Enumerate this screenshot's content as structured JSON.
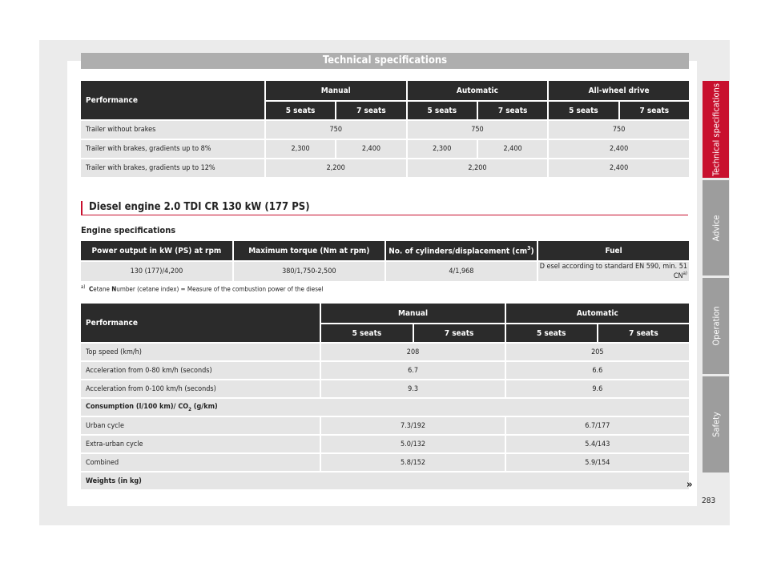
{
  "title": "Technical specifications",
  "table1": {
    "header_performance": "Performance",
    "groups": [
      "Manual",
      "Automatic",
      "All-wheel drive"
    ],
    "seats": [
      "5 seats",
      "7 seats",
      "5 seats",
      "7 seats",
      "5 seats",
      "7 seats"
    ],
    "rows": [
      {
        "label": "Trailer without brakes",
        "manual": "750",
        "automatic": "750",
        "awd": "750"
      },
      {
        "label": "Trailer with brakes, gradients up to 8%",
        "m5": "2,300",
        "m7": "2,400",
        "a5": "2,300",
        "a7": "2,400",
        "awd": "2,400"
      },
      {
        "label": "Trailer with brakes, gradients up to 12%",
        "manual": "2,200",
        "automatic": "2,200",
        "awd": "2,400"
      }
    ]
  },
  "section_title": "Diesel engine 2.0 TDI CR 130 kW (177 PS)",
  "engine_specs_title": "Engine specifications",
  "engine_table": {
    "headers": [
      "Power output in kW (PS) at rpm",
      "Maximum torque (Nm at rpm)",
      "No. of cylinders/displacement (cm",
      "Fuel"
    ],
    "header_sup": "3",
    "header_close": ")",
    "row": [
      "130 (177)/4,200",
      "380/1,750-2,500",
      "4/1,968",
      "D esel according to standard EN 590, min.  51 CN"
    ],
    "row_sup": "a)"
  },
  "footnote": {
    "mark": "a)",
    "c": "C",
    "etane": "etane ",
    "n": "N",
    "rest": "umber (cetane index) = Measure of the combustion power of the diesel"
  },
  "table2": {
    "header_performance": "Performance",
    "groups": [
      "Manual",
      "Automatic"
    ],
    "seats": [
      "5 seats",
      "7 seats",
      "5 seats",
      "7 seats"
    ],
    "rows": [
      {
        "label": "Top speed (km/h)",
        "manual": "208",
        "automatic": "205"
      },
      {
        "label": "Acceleration from 0-80 km/h (seconds)",
        "manual": "6.7",
        "automatic": "6.6"
      },
      {
        "label": "Acceleration from 0-100 km/h (seconds)",
        "manual": "9.3",
        "automatic": "9.6"
      }
    ],
    "consumption_label_a": "Consumption (l/100 km)/ CO",
    "consumption_label_sub": "2",
    "consumption_label_b": " (g/km)",
    "rows2": [
      {
        "label": "Urban cycle",
        "manual": "7.3/192",
        "automatic": "6.7/177"
      },
      {
        "label": "Extra-urban cycle",
        "manual": "5.0/132",
        "automatic": "5.4/143"
      },
      {
        "label": "Combined",
        "manual": "5.8/152",
        "automatic": "5.9/154"
      }
    ],
    "weights_label": "Weights (in kg)"
  },
  "more_icon": "»",
  "side_tabs": [
    "Technical specifications",
    "Advice",
    "Operation",
    "Safety"
  ],
  "colors": {
    "active_tab": "#c8102e",
    "inactive_tab": "#9d9d9d",
    "header": "#2b2b2b",
    "cell": "#e5e5e5"
  },
  "page_number": "283"
}
